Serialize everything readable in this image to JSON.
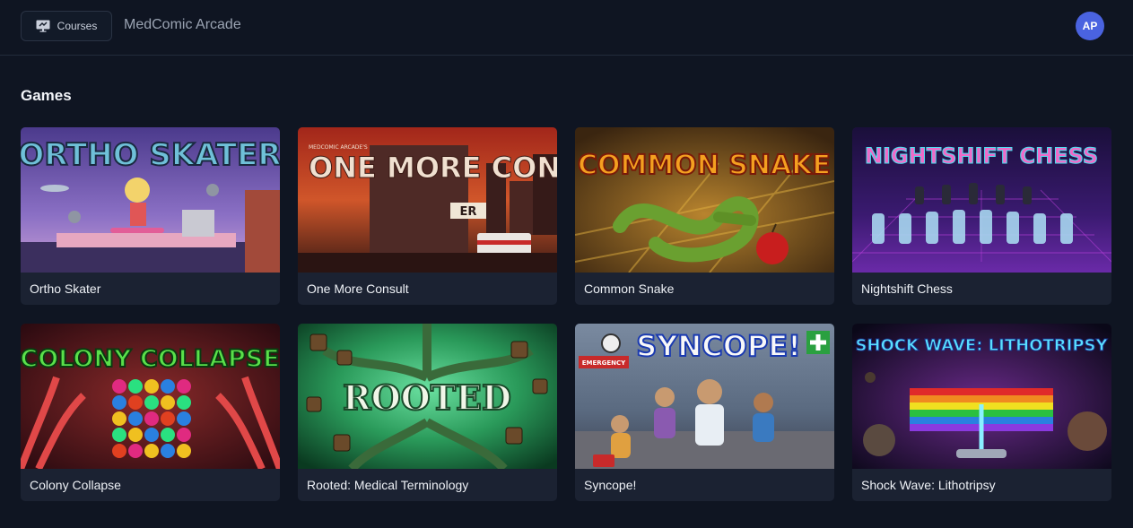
{
  "header": {
    "courses_label": "Courses",
    "app_title": "MedComic Arcade",
    "avatar_initials": "AP"
  },
  "section_title": "Games",
  "games": [
    {
      "title": "Ortho Skater",
      "art_text": "ORTHO SKATER"
    },
    {
      "title": "One More Consult",
      "art_text": "ONE MORE CONSULT",
      "art_kicker": "MEDCOMIC ARCADE'S",
      "art_sign": "ER"
    },
    {
      "title": "Common Snake",
      "art_text": "COMMON SNAKE"
    },
    {
      "title": "Nightshift Chess",
      "art_text": "NIGHTSHIFT CHESS"
    },
    {
      "title": "Colony Collapse",
      "art_text": "COLONY COLLAPSE"
    },
    {
      "title": "Rooted: Medical Terminology",
      "art_text": "ROOTED"
    },
    {
      "title": "Syncope!",
      "art_text": "SYNCOPE!",
      "art_sign": "EMERGENCY"
    },
    {
      "title": "Shock Wave: Lithotripsy",
      "art_text": "SHOCK WAVE: LITHOTRIPSY"
    }
  ]
}
